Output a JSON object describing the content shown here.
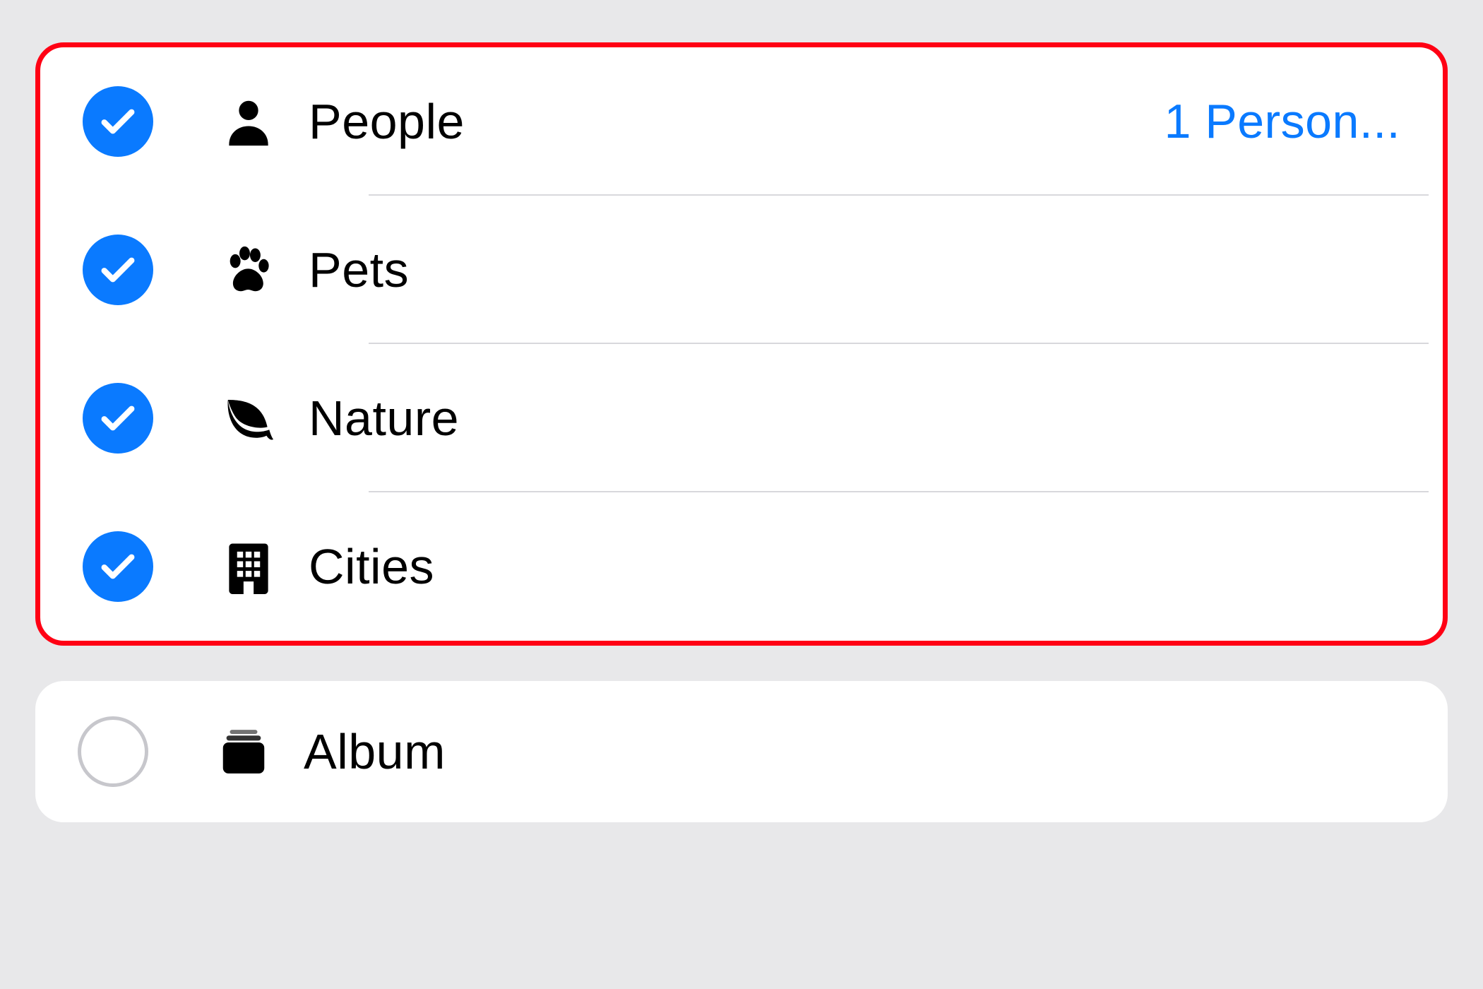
{
  "colors": {
    "accent": "#0a7aff",
    "highlight_border": "#ff0014",
    "divider": "#d8d8dc",
    "unchecked_ring": "#c7c7cc",
    "bg": "#e8e8ea"
  },
  "group_highlighted": true,
  "group_rows": [
    {
      "icon": "person-icon",
      "label": "People",
      "trailing": "1 Person...",
      "checked": true
    },
    {
      "icon": "pawprint-icon",
      "label": "Pets",
      "trailing": "",
      "checked": true
    },
    {
      "icon": "leaf-icon",
      "label": "Nature",
      "trailing": "",
      "checked": true
    },
    {
      "icon": "building-icon",
      "label": "Cities",
      "trailing": "",
      "checked": true
    }
  ],
  "single_row": {
    "icon": "album-stack-icon",
    "label": "Album",
    "trailing": "",
    "checked": false
  }
}
